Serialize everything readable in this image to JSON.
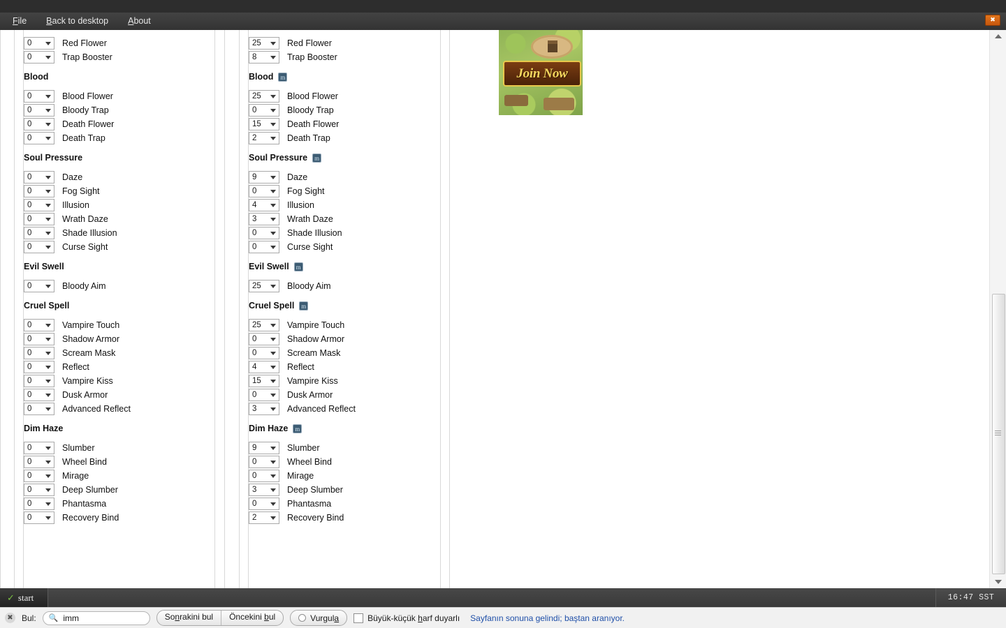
{
  "window": {
    "menu": [
      {
        "label": "File",
        "accel": "F"
      },
      {
        "label": "Back to desktop",
        "accel": "B"
      },
      {
        "label": "About",
        "accel": "A"
      }
    ],
    "close_label": "✖"
  },
  "badge": {
    "letter": "m"
  },
  "columns": [
    {
      "id": "left",
      "groups": [
        {
          "title": "",
          "has_badge": false,
          "rows": [
            {
              "value": "0",
              "label": "Red Flower"
            },
            {
              "value": "0",
              "label": "Trap Booster"
            }
          ]
        },
        {
          "title": "Blood",
          "has_badge": false,
          "rows": [
            {
              "value": "0",
              "label": "Blood Flower"
            },
            {
              "value": "0",
              "label": "Bloody Trap"
            },
            {
              "value": "0",
              "label": "Death Flower"
            },
            {
              "value": "0",
              "label": "Death Trap"
            }
          ]
        },
        {
          "title": "Soul Pressure",
          "has_badge": false,
          "rows": [
            {
              "value": "0",
              "label": "Daze"
            },
            {
              "value": "0",
              "label": "Fog Sight"
            },
            {
              "value": "0",
              "label": "Illusion"
            },
            {
              "value": "0",
              "label": "Wrath Daze"
            },
            {
              "value": "0",
              "label": "Shade Illusion"
            },
            {
              "value": "0",
              "label": "Curse Sight"
            }
          ]
        },
        {
          "title": "Evil Swell",
          "has_badge": false,
          "rows": [
            {
              "value": "0",
              "label": "Bloody Aim"
            }
          ]
        },
        {
          "title": "Cruel Spell",
          "has_badge": false,
          "rows": [
            {
              "value": "0",
              "label": "Vampire Touch"
            },
            {
              "value": "0",
              "label": "Shadow Armor"
            },
            {
              "value": "0",
              "label": "Scream Mask"
            },
            {
              "value": "0",
              "label": "Reflect"
            },
            {
              "value": "0",
              "label": "Vampire Kiss"
            },
            {
              "value": "0",
              "label": "Dusk Armor"
            },
            {
              "value": "0",
              "label": "Advanced Reflect"
            }
          ]
        },
        {
          "title": "Dim Haze",
          "has_badge": false,
          "rows": [
            {
              "value": "0",
              "label": "Slumber"
            },
            {
              "value": "0",
              "label": "Wheel Bind"
            },
            {
              "value": "0",
              "label": "Mirage"
            },
            {
              "value": "0",
              "label": "Deep Slumber"
            },
            {
              "value": "0",
              "label": "Phantasma"
            },
            {
              "value": "0",
              "label": "Recovery Bind"
            }
          ]
        }
      ]
    },
    {
      "id": "right",
      "groups": [
        {
          "title": "",
          "has_badge": false,
          "rows": [
            {
              "value": "25",
              "label": "Red Flower"
            },
            {
              "value": "8",
              "label": "Trap Booster"
            }
          ]
        },
        {
          "title": "Blood",
          "has_badge": true,
          "rows": [
            {
              "value": "25",
              "label": "Blood Flower"
            },
            {
              "value": "0",
              "label": "Bloody Trap"
            },
            {
              "value": "15",
              "label": "Death Flower"
            },
            {
              "value": "2",
              "label": "Death Trap"
            }
          ]
        },
        {
          "title": "Soul Pressure",
          "has_badge": true,
          "rows": [
            {
              "value": "9",
              "label": "Daze"
            },
            {
              "value": "0",
              "label": "Fog Sight"
            },
            {
              "value": "4",
              "label": "Illusion"
            },
            {
              "value": "3",
              "label": "Wrath Daze"
            },
            {
              "value": "0",
              "label": "Shade Illusion"
            },
            {
              "value": "0",
              "label": "Curse Sight"
            }
          ]
        },
        {
          "title": "Evil Swell",
          "has_badge": true,
          "rows": [
            {
              "value": "25",
              "label": "Bloody Aim"
            }
          ]
        },
        {
          "title": "Cruel Spell",
          "has_badge": true,
          "rows": [
            {
              "value": "25",
              "label": "Vampire Touch"
            },
            {
              "value": "0",
              "label": "Shadow Armor"
            },
            {
              "value": "0",
              "label": "Scream Mask"
            },
            {
              "value": "4",
              "label": "Reflect"
            },
            {
              "value": "15",
              "label": "Vampire Kiss"
            },
            {
              "value": "0",
              "label": "Dusk Armor"
            },
            {
              "value": "3",
              "label": "Advanced Reflect"
            }
          ]
        },
        {
          "title": "Dim Haze",
          "has_badge": true,
          "rows": [
            {
              "value": "9",
              "label": "Slumber"
            },
            {
              "value": "0",
              "label": "Wheel Bind"
            },
            {
              "value": "0",
              "label": "Mirage"
            },
            {
              "value": "3",
              "label": "Deep Slumber"
            },
            {
              "value": "0",
              "label": "Phantasma"
            },
            {
              "value": "2",
              "label": "Recovery Bind"
            }
          ]
        }
      ]
    }
  ],
  "banner": {
    "cta": "Join Now"
  },
  "taskbar": {
    "start_label": "start",
    "start_icon": "leaf-icon",
    "clock": "16:47 SST"
  },
  "findbar": {
    "close_icon": "close-icon",
    "label": "Bul:",
    "query": "imm",
    "placeholder": "",
    "next_button": "Sonrakini bul",
    "prev_button": "Öncekini bul",
    "highlight_button": "Vurgula",
    "match_case_label": "Büyük-küçük harf duyarlı",
    "status": "Sayfanın sonuna gelindi; baştan aranıyor."
  },
  "scrollbar": {
    "up_icon": "chevron-up-icon",
    "down_icon": "chevron-down-icon"
  }
}
